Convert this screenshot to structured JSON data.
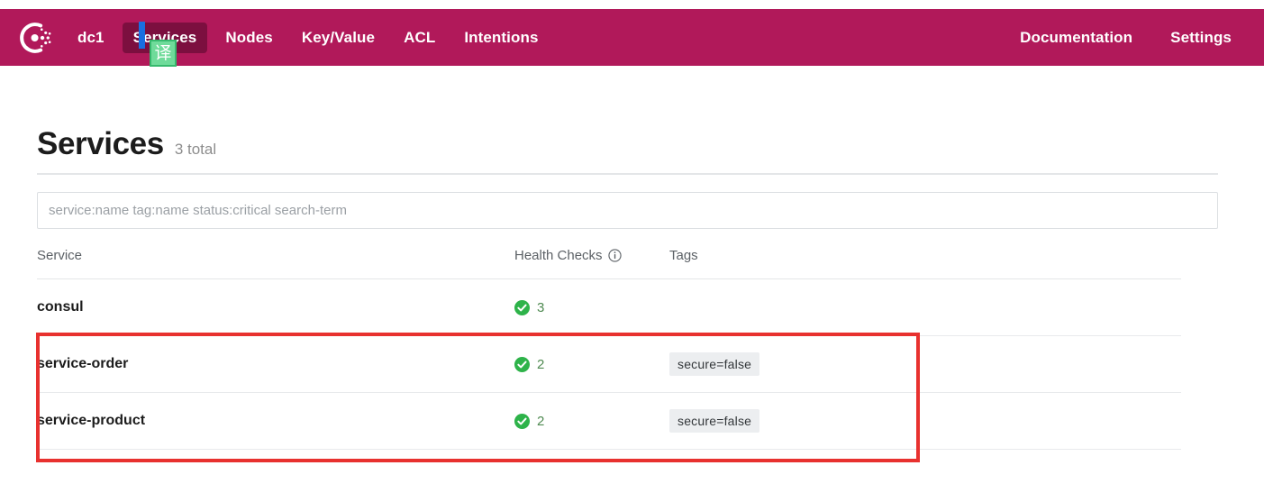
{
  "navbar": {
    "logo_icon": "consul-logo-icon",
    "brand_color": "#b1195a",
    "active_tab_color": "#7c0f3f",
    "left_items": [
      {
        "label": "dc1",
        "name": "datacenter",
        "active": false
      },
      {
        "label": "Services",
        "name": "services",
        "active": true
      },
      {
        "label": "Nodes",
        "name": "nodes",
        "active": false
      },
      {
        "label": "Key/Value",
        "name": "key-value",
        "active": false
      },
      {
        "label": "ACL",
        "name": "acl",
        "active": false
      },
      {
        "label": "Intentions",
        "name": "intentions",
        "active": false
      }
    ],
    "right_items": [
      {
        "label": "Documentation",
        "name": "documentation"
      },
      {
        "label": "Settings",
        "name": "settings"
      }
    ]
  },
  "overlay": {
    "translate_badge_glyph": "译",
    "translate_badge_color": "#6fdb9a",
    "caret_color": "#1a6fe0"
  },
  "page": {
    "title": "Services",
    "count_label": "3 total"
  },
  "search": {
    "value": "",
    "placeholder": "service:name tag:name status:critical search-term"
  },
  "table": {
    "columns": [
      {
        "label": "Service",
        "name": "service"
      },
      {
        "label": "Health Checks",
        "name": "health-checks",
        "icon": "info-icon"
      },
      {
        "label": "Tags",
        "name": "tags"
      }
    ],
    "rows": [
      {
        "service": "consul",
        "health_status": "passing",
        "health_icon": "check-circle-icon",
        "health_count": "3",
        "tags": []
      },
      {
        "service": "service-order",
        "health_status": "passing",
        "health_icon": "check-circle-icon",
        "health_count": "2",
        "tags": [
          "secure=false"
        ]
      },
      {
        "service": "service-product",
        "health_status": "passing",
        "health_icon": "check-circle-icon",
        "health_count": "2",
        "tags": [
          "secure=false"
        ]
      }
    ]
  },
  "annotation": {
    "color": "#e8312f",
    "shape": "rectangle-highlight"
  }
}
